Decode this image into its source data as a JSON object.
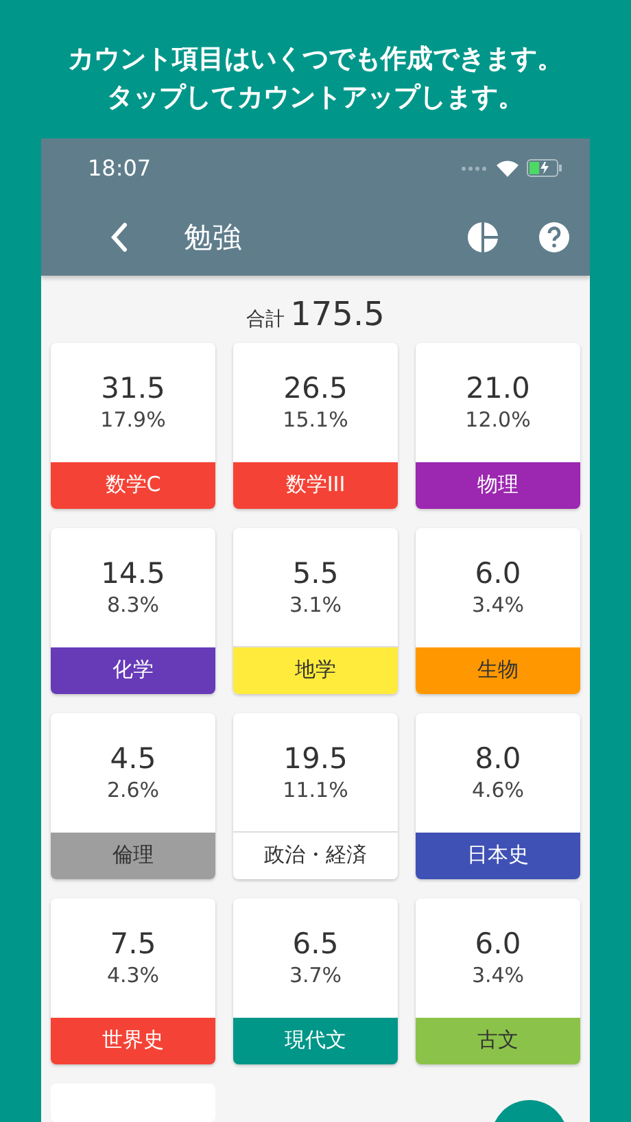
{
  "headline": [
    "カウント項目はいくつでも作成できます。",
    "タップしてカウントアップします。"
  ],
  "status_bar": {
    "time": "18:07"
  },
  "app_bar": {
    "title": "勉強"
  },
  "total": {
    "label": "合計",
    "value": "175.5"
  },
  "counters": [
    {
      "value": "31.5",
      "percent": "17.9%",
      "name": "数学C",
      "color": "#f44336"
    },
    {
      "value": "26.5",
      "percent": "15.1%",
      "name": "数学III",
      "color": "#f44336"
    },
    {
      "value": "21.0",
      "percent": "12.0%",
      "name": "物理",
      "color": "#9c27b0"
    },
    {
      "value": "14.5",
      "percent": "8.3%",
      "name": "化学",
      "color": "#673ab7"
    },
    {
      "value": "5.5",
      "percent": "3.1%",
      "name": "地学",
      "color": "#ffeb3b"
    },
    {
      "value": "6.0",
      "percent": "3.4%",
      "name": "生物",
      "color": "#ff9800"
    },
    {
      "value": "4.5",
      "percent": "2.6%",
      "name": "倫理",
      "color": "#9e9e9e"
    },
    {
      "value": "19.5",
      "percent": "11.1%",
      "name": "政治・経済",
      "color": "#ffffff"
    },
    {
      "value": "8.0",
      "percent": "4.6%",
      "name": "日本史",
      "color": "#3f51b5"
    },
    {
      "value": "7.5",
      "percent": "4.3%",
      "name": "世界史",
      "color": "#f44336"
    },
    {
      "value": "6.5",
      "percent": "3.7%",
      "name": "現代文",
      "color": "#009688"
    },
    {
      "value": "6.0",
      "percent": "3.4%",
      "name": "古文",
      "color": "#8bc34a"
    }
  ]
}
